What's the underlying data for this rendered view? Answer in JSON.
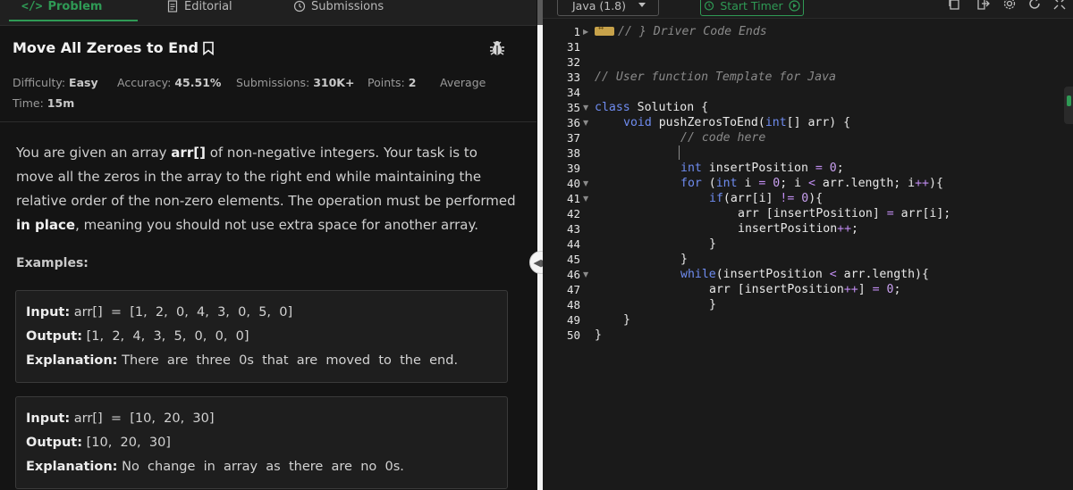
{
  "tabs": {
    "problem": "Problem",
    "editorial": "Editorial",
    "submissions": "Submissions"
  },
  "problem": {
    "title": "Move All Zeroes to End",
    "difficulty_label": "Difficulty:",
    "difficulty": "Easy",
    "accuracy_label": "Accuracy:",
    "accuracy": "45.51%",
    "submissions_label": "Submissions:",
    "submissions": "310K+",
    "points_label": "Points:",
    "points": "2",
    "average": "Average",
    "time_label": "Time:",
    "time": "15m",
    "desc_1": "You are given an array ",
    "desc_arr": "arr[]",
    "desc_2": " of non-negative integers. Your task is to move all the zeros in the array to the right end while maintaining the relative order of the non-zero elements. The operation must be performed ",
    "desc_inplace": "in place",
    "desc_3": ", meaning you should not use extra space for another array.",
    "examples_label": "Examples:",
    "examples": [
      {
        "input_label": "Input:",
        "input": " arr[]  =  [1,  2,  0,  4,  3,  0,  5,  0]",
        "output_label": "Output:",
        "output": " [1,  2,  4,  3,  5,  0,  0,  0]",
        "explanation_label": "Explanation:",
        "explanation": " There  are  three  0s  that  are  moved  to  the  end."
      },
      {
        "input_label": "Input:",
        "input": " arr[]  =  [10,  20,  30]",
        "output_label": "Output:",
        "output": " [10,  20,  30]",
        "explanation_label": "Explanation:",
        "explanation": " No  change  in  array  as  there  are  no  0s."
      }
    ]
  },
  "editor": {
    "language": "Java (1.8)",
    "timer_label": "Start Timer",
    "line_numbers": [
      "1",
      "31",
      "32",
      "33",
      "34",
      "35",
      "36",
      "37",
      "38",
      "39",
      "40",
      "41",
      "42",
      "43",
      "44",
      "45",
      "46",
      "47",
      "48",
      "49",
      "50"
    ],
    "comment_driver": "// } Driver Code Ends",
    "comment_template": "// User function Template for Java",
    "comment_code_here": "// code here"
  },
  "colors": {
    "accent": "#2f9a55",
    "keyword": "#6f8cf0",
    "number": "#c9a0f0",
    "comment": "#8a8a8a"
  }
}
